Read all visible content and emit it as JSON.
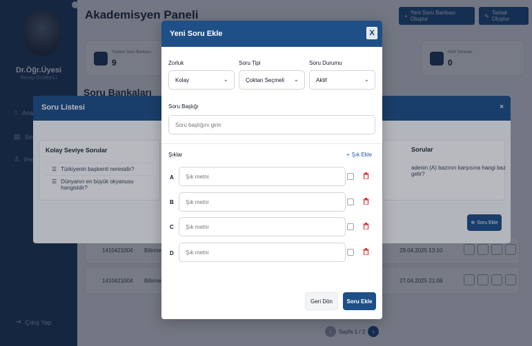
{
  "sidebar": {
    "user_name": "Dr.Öğr.Üyesi",
    "user_sub": "Recep ÖLMEKLİ",
    "items": [
      {
        "label": "Ana",
        "icon": "home-icon"
      },
      {
        "label": "Sına",
        "icon": "document-icon"
      },
      {
        "label": "Pro",
        "icon": "user-icon"
      }
    ],
    "logout": "Çıkış Yap"
  },
  "main": {
    "title": "Akademisyen Paneli",
    "btn_new_bank": "Yeni Soru Bankası Oluştur",
    "btn_draft": "Taslak Oluştur",
    "stats": [
      {
        "label": "Toplam Soru Bankası",
        "value": "9"
      },
      {
        "label": "Aktif Sınavlar",
        "value": "0"
      }
    ],
    "section_heading": "Soru Bankaları",
    "rows": [
      {
        "id": "1410421004",
        "name": "Bitirme P",
        "date": "29.04.2025 13:10"
      },
      {
        "id": "1410421004",
        "name": "Bitirme P",
        "date": "27.04.2025 21:08"
      }
    ],
    "pager": "Sayfa 1 / 2"
  },
  "list_dialog": {
    "title": "Soru Listesi",
    "close": "×",
    "easy_title": "Kolay Seviye Sorular",
    "easy_questions": [
      "Türkiyenin başkenti neresidir?",
      "Dünyanın en büyük okyanusu hangisidir?"
    ],
    "hard_title": "Sorular",
    "hard_question": "adenin (A) bazının karşısına hangi baz gelir?",
    "add_button": "Soru Ekle"
  },
  "modal": {
    "title": "Yeni Soru Ekle",
    "close": "X",
    "difficulty_label": "Zorluk",
    "difficulty_value": "Kolay",
    "type_label": "Soru Tipi",
    "type_value": "Çoktan Seçmeli",
    "status_label": "Soru Durumu",
    "status_value": "Aktif",
    "question_title_label": "Soru Başlığı",
    "question_title_placeholder": "Soru başlığını girin",
    "options_label": "Şıklar",
    "add_option": "Şık Ekle",
    "option_placeholder": "Şık metni",
    "options": [
      "A",
      "B",
      "C",
      "D"
    ],
    "back_button": "Geri Dön",
    "submit_button": "Soru Ekle"
  }
}
